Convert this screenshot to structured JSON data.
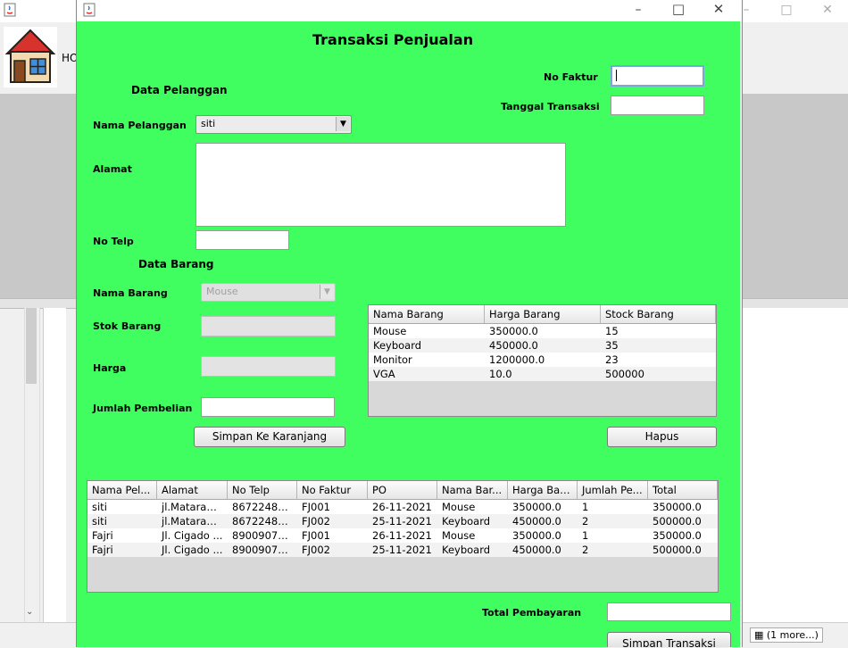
{
  "background_window": {
    "toolbar_text": "HO",
    "status_text": "(1 more...)"
  },
  "frame": {
    "title": "Transaksi Penjualan"
  },
  "invoice": {
    "no_faktur_label": "No Faktur",
    "no_faktur_value": "",
    "tanggal_label": "Tanggal Transaksi",
    "tanggal_value": ""
  },
  "pelanggan": {
    "section_label": "Data Pelanggan",
    "nama_label": "Nama Pelanggan",
    "nama_value": "siti",
    "alamat_label": "Alamat",
    "alamat_value": "",
    "telp_label": "No Telp",
    "telp_value": ""
  },
  "barang": {
    "section_label": "Data Barang",
    "nama_label": "Nama Barang",
    "nama_value": "Mouse",
    "stok_label": "Stok Barang",
    "stok_value": "",
    "harga_label": "Harga",
    "harga_value": "",
    "jumlah_label": "Jumlah Pembelian",
    "jumlah_value": ""
  },
  "buttons": {
    "simpan_keranjang": "Simpan Ke Karanjang",
    "hapus": "Hapus",
    "simpan_transaksi": "Simpan Transaksi"
  },
  "stock_table": {
    "columns": [
      "Nama Barang",
      "Harga Barang",
      "Stock Barang"
    ],
    "rows": [
      [
        "Mouse",
        "350000.0",
        "15"
      ],
      [
        "Keyboard",
        "450000.0",
        "35"
      ],
      [
        "Monitor",
        "1200000.0",
        "23"
      ],
      [
        "VGA",
        "10.0",
        "500000"
      ]
    ]
  },
  "cart_table": {
    "columns": [
      "Nama Pel...",
      "Alamat",
      "No Telp",
      "No Faktur",
      "PO",
      "Nama Bar...",
      "Harga Bar...",
      "Jumlah Pe...",
      "Total"
    ],
    "rows": [
      [
        "siti",
        "jl.Mataram ...",
        "86722484...",
        "FJ001",
        "26-11-2021",
        "Mouse",
        "350000.0",
        "1",
        "350000.0"
      ],
      [
        "siti",
        "jl.Mataram ...",
        "86722484...",
        "FJ002",
        "25-11-2021",
        "Keyboard",
        "450000.0",
        "2",
        "500000.0"
      ],
      [
        "Fajri",
        "Jl. Cigado ...",
        "89009076...",
        "FJ001",
        "26-11-2021",
        "Mouse",
        "350000.0",
        "1",
        "350000.0"
      ],
      [
        "Fajri",
        "Jl. Cigado ...",
        "89009076...",
        "FJ002",
        "25-11-2021",
        "Keyboard",
        "450000.0",
        "2",
        "500000.0"
      ]
    ]
  },
  "total": {
    "label": "Total Pembayaran",
    "value": ""
  },
  "icons": {
    "app": "java-icon",
    "logo": "house-icon",
    "minimize": "minimize-icon",
    "maximize": "maximize-icon",
    "close": "close-icon"
  }
}
